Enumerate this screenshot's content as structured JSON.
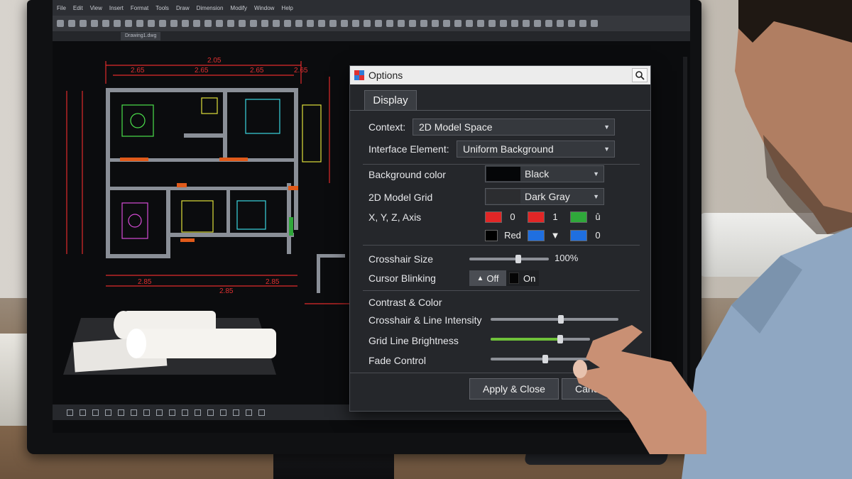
{
  "app": {
    "doc_tab": "Drawing1.dwg",
    "menu_items": [
      "File",
      "Edit",
      "View",
      "Insert",
      "Format",
      "Tools",
      "Draw",
      "Dimension",
      "Modify",
      "Window",
      "Help"
    ]
  },
  "drawing": {
    "dimensions_top": [
      "2.05",
      "2.65",
      "2.65",
      "2.65",
      "2.65"
    ],
    "dimensions_bottom": [
      "2.85",
      "2.85",
      "2.85"
    ]
  },
  "dialog": {
    "title": "Options",
    "tab": "Display",
    "context_label": "Context:",
    "context_value": "2D Model Space",
    "interface_label": "Interface Element:",
    "interface_value": "Uniform Background",
    "bg_color_label": "Background color",
    "bg_color_value": "Black",
    "grid_label": "2D Model Grid",
    "grid_value": "Dark Gray",
    "axis_label": "X, Y, Z, Axis",
    "axis_row1": [
      {
        "color": "#e22626",
        "value": "0"
      },
      {
        "color": "#e22626",
        "value": "1"
      },
      {
        "color": "#2fa83a",
        "value": "û"
      }
    ],
    "axis_row2": [
      {
        "color": "#000000",
        "value": "Red"
      },
      {
        "color": "#1f6fe0",
        "value": "▼"
      },
      {
        "color": "#1f6fe0",
        "value": "0"
      }
    ],
    "crosshair_label": "Crosshair Size",
    "crosshair_value": "100%",
    "crosshair_fraction": 0.62,
    "blink_label": "Cursor Blinking",
    "blink_off": "Off",
    "blink_on": "On",
    "contrast_heading": "Contrast & Color",
    "intensity_label": "Crosshair & Line Intensity",
    "brightness_label": "Grid Line Brightness",
    "fade_label": "Fade Control",
    "intensity_fraction": 0.55,
    "brightness_fraction": 0.7,
    "fade_fraction": 0.55,
    "apply_label": "Apply & Close",
    "cancel_label": "Cancel"
  },
  "colors": {
    "accent_red": "#e22626",
    "accent_green": "#6fc23a",
    "accent_blue": "#1f6fe0",
    "dialog_bg": "#25272b"
  }
}
